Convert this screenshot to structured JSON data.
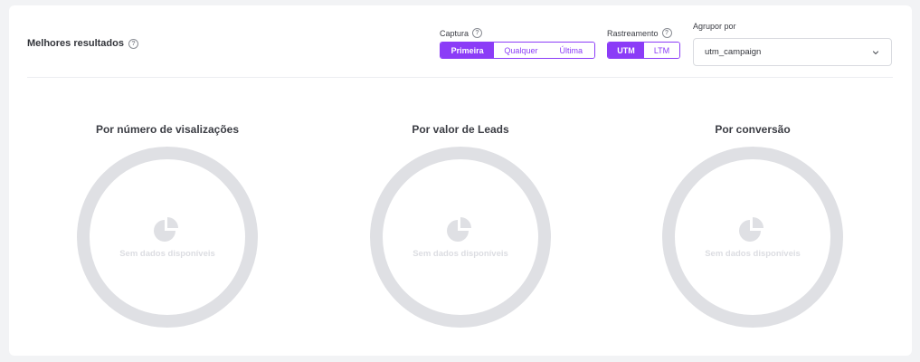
{
  "widget": {
    "title": "Melhores resultados",
    "help_glyph": "?"
  },
  "capture": {
    "label": "Captura",
    "options": [
      "Primeira",
      "Qualquer",
      "Última"
    ],
    "selected": "Primeira"
  },
  "tracking": {
    "label": "Rastreamento",
    "options": [
      "UTM",
      "LTM"
    ],
    "selected": "UTM"
  },
  "group_by": {
    "label": "Agrupor por",
    "value": "utm_campaign"
  },
  "panels": [
    {
      "title": "Por número de visalizações",
      "empty_text": "Sem dados disponíveis"
    },
    {
      "title": "Por valor de Leads",
      "empty_text": "Sem dados disponíveis"
    },
    {
      "title": "Por conversão",
      "empty_text": "Sem dados disponíveis"
    }
  ],
  "colors": {
    "accent": "#8b3cf7",
    "ring": "#dfe0e4",
    "empty_text": "#dcdde2",
    "background": "#f2f3f5",
    "card": "#ffffff"
  },
  "icons": {
    "help": "question-circle-icon",
    "dropdown": "chevron-down-icon",
    "empty": "pie-chart-icon"
  }
}
